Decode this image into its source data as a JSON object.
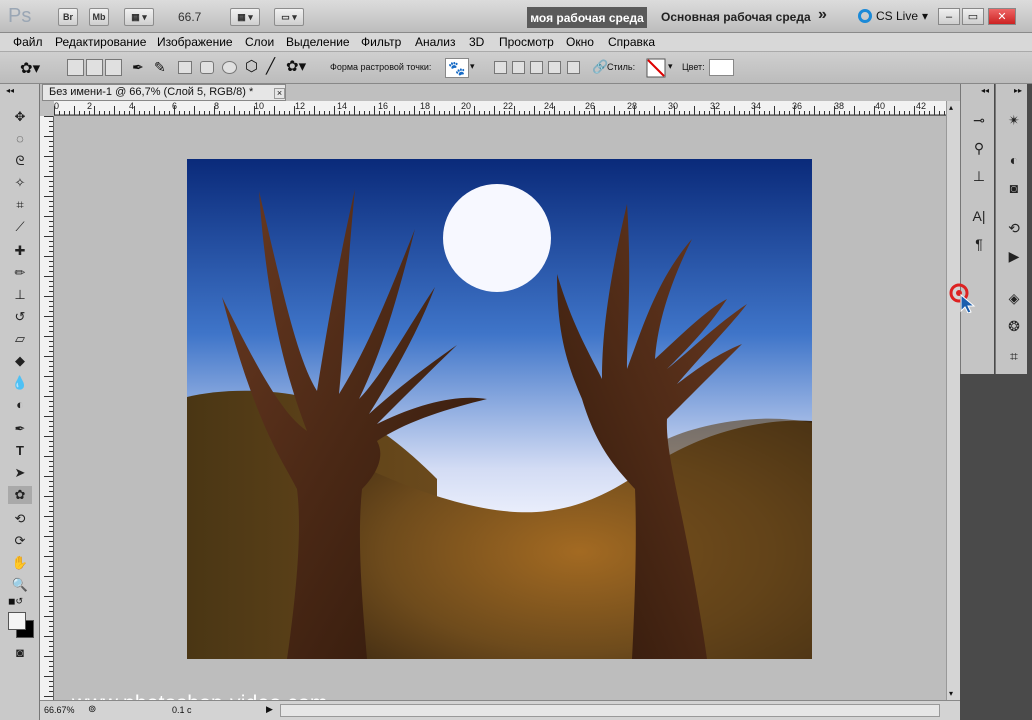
{
  "appbar": {
    "logo": "Ps",
    "br_label": "Br",
    "mb_label": "Mb",
    "zoom": "66.7",
    "workspace_active": "моя рабочая среда",
    "workspace_main": "Основная рабочая среда",
    "more": "»",
    "cs_live": "CS Live",
    "minimize": "–",
    "restore": "▭",
    "close": "✕"
  },
  "menu": [
    "Файл",
    "Редактирование",
    "Изображение",
    "Слои",
    "Выделение",
    "Фильтр",
    "Анализ",
    "3D",
    "Просмотр",
    "Окно",
    "Справка"
  ],
  "options": {
    "brush_shape_label": "Форма растровой точки:",
    "style_label": "Стиль:",
    "color_label": "Цвет:",
    "brush_icon": "paw-icon"
  },
  "document": {
    "tab_title": "Без имени-1 @ 66,7% (Слой 5, RGB/8) *",
    "tab_close": "×",
    "zoom_status": "66.67%",
    "time_status": "0.1 с",
    "watermark": "www.photoshop-video.com",
    "ruler_numbers": [
      "0",
      "2",
      "4",
      "6",
      "8",
      "10",
      "12",
      "14",
      "16",
      "18",
      "20",
      "22",
      "24",
      "26",
      "28",
      "30",
      "32",
      "34",
      "36",
      "38",
      "40",
      "42"
    ]
  },
  "colors": {
    "sky_top": "#0a2a7a",
    "sky_bottom": "#f4f6ff",
    "moon": "#f7f8ff",
    "hill": "#6b4a1e",
    "tree": "#4a2612"
  }
}
